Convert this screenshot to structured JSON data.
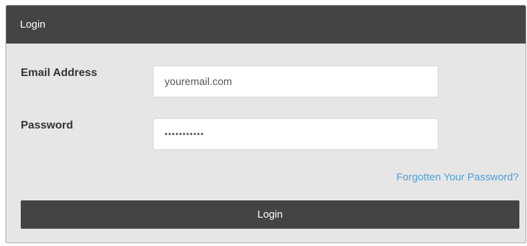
{
  "panel": {
    "title": "Login"
  },
  "form": {
    "email_label": "Email Address",
    "email_value": "youremail.com",
    "password_label": "Password",
    "password_value": "•••••••••••",
    "forgot_link": "Forgotten Your Password?",
    "submit_label": "Login"
  },
  "colors": {
    "header_bg": "#444444",
    "panel_bg": "#e6e6e6",
    "link": "#4a9fd6",
    "button_bg": "#444444"
  }
}
